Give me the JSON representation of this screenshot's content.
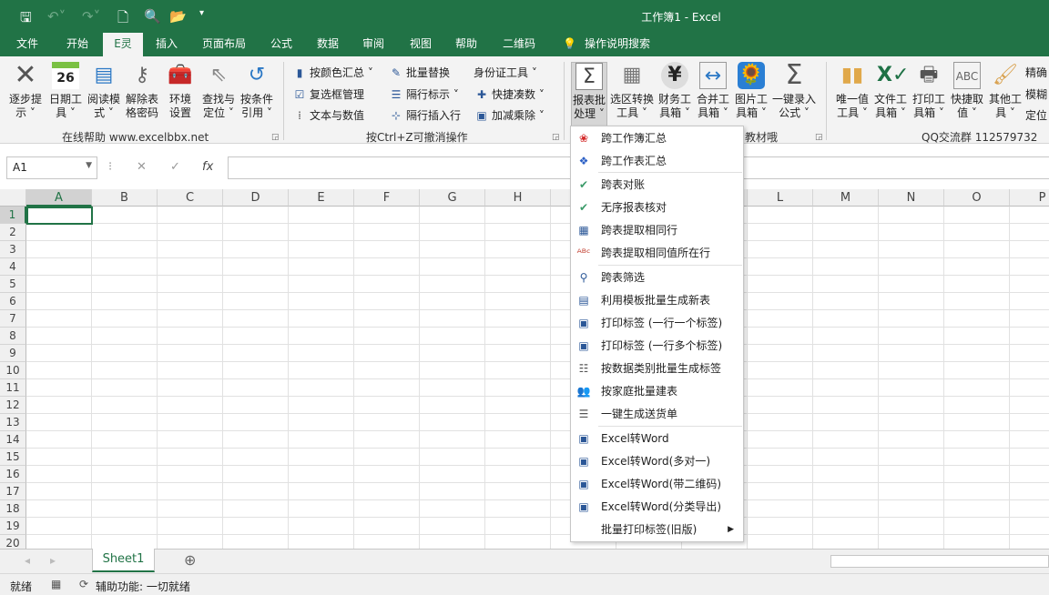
{
  "title": "工作簿1  -  Excel",
  "quick_access": [
    "save-icon",
    "undo-icon",
    "redo-icon",
    "new-icon",
    "print-preview-icon",
    "open-icon",
    "customize-icon"
  ],
  "tabs": [
    "文件",
    "开始",
    "E灵",
    "插入",
    "页面布局",
    "公式",
    "数据",
    "审阅",
    "视图",
    "帮助",
    "二维码",
    "操作说明搜索"
  ],
  "active_tab": "E灵",
  "ribbon": {
    "group1": {
      "label": "在线帮助  www.excelbbx.net",
      "buttons": [
        [
          "逐步提",
          "示 ˅"
        ],
        [
          "日期工",
          "具 ˅"
        ],
        [
          "阅读模",
          "式 ˅"
        ],
        [
          "解除表",
          "格密码"
        ],
        [
          "环境",
          "设置"
        ],
        [
          "查找与",
          "定位 ˅"
        ],
        [
          "按条件",
          "引用 ˅"
        ]
      ],
      "calendar_day": "26"
    },
    "group2": {
      "label": "按Ctrl+Z可撤消操作",
      "items": [
        "按颜色汇总 ˅",
        "复选框管理",
        "文本与数值",
        "批量替换",
        "隔行标示 ˅",
        "隔行插入行",
        "身份证工具 ˅",
        "快捷凑数 ˅",
        "加减乘除 ˅"
      ]
    },
    "group3": {
      "label": "教材哦",
      "buttons": [
        [
          "报表批",
          "处理 ˅"
        ],
        [
          "选区转换",
          "工具 ˅"
        ],
        [
          "财务工",
          "具箱 ˅"
        ],
        [
          "合并工",
          "具箱 ˅"
        ],
        [
          "图片工",
          "具箱 ˅"
        ],
        [
          "一键录入",
          "公式 ˅"
        ]
      ]
    },
    "group4": {
      "label": "QQ交流群  112579732",
      "buttons": [
        [
          "唯一值",
          "工具 ˅"
        ],
        [
          "文件工",
          "具箱 ˅"
        ],
        [
          "打印工",
          "具箱 ˅"
        ],
        [
          "快捷取",
          "值 ˅"
        ],
        [
          "其他工",
          "具 ˅"
        ]
      ],
      "side": [
        "精确",
        "模糊",
        "定位"
      ]
    }
  },
  "name_box": "A1",
  "formula_icons": [
    "✕",
    "✓",
    "fx"
  ],
  "formula_value": "",
  "columns": [
    "A",
    "B",
    "C",
    "D",
    "E",
    "F",
    "G",
    "H",
    "I",
    "J",
    "K",
    "L",
    "M",
    "N",
    "O",
    "P"
  ],
  "rows": [
    "1",
    "2",
    "3",
    "4",
    "5",
    "6",
    "7",
    "8",
    "9",
    "10",
    "11",
    "12",
    "13",
    "14",
    "15",
    "16",
    "17",
    "18",
    "19",
    "20"
  ],
  "active_cell": "A1",
  "sheets": [
    "Sheet1"
  ],
  "status": {
    "ready": "就绪",
    "accessibility": "辅助功能: 一切就绪"
  },
  "menu": [
    {
      "label": "跨工作簿汇总",
      "icon": "workbook-merge-icon"
    },
    {
      "label": "跨工作表汇总",
      "icon": "sheet-merge-icon"
    },
    {
      "label": "跨表对账",
      "icon": "check-icon"
    },
    {
      "label": "无序报表核对",
      "icon": "check-icon"
    },
    {
      "label": "跨表提取相同行",
      "icon": "table-icon"
    },
    {
      "label": "跨表提取相同值所在行",
      "icon": "abc-icon"
    },
    {
      "label": "跨表筛选",
      "icon": "search-icon"
    },
    {
      "label": "利用模板批量生成新表",
      "icon": "template-icon"
    },
    {
      "label": "打印标签 (一行一个标签)",
      "icon": "label-icon"
    },
    {
      "label": "打印标签 (一行多个标签)",
      "icon": "label-icon"
    },
    {
      "label": "按数据类别批量生成标签",
      "icon": "list-icon"
    },
    {
      "label": "按家庭批量建表",
      "icon": "family-icon"
    },
    {
      "label": "一键生成送货单",
      "icon": "invoice-icon"
    },
    {
      "label": "Excel转Word",
      "icon": "word-icon"
    },
    {
      "label": "Excel转Word(多对一)",
      "icon": "word-icon"
    },
    {
      "label": "Excel转Word(带二维码)",
      "icon": "word-icon"
    },
    {
      "label": "Excel转Word(分类导出)",
      "icon": "word-icon"
    },
    {
      "label": "批量打印标签(旧版)",
      "icon": "",
      "submenu": true
    }
  ],
  "colors": {
    "accent": "#217346",
    "ribbon_bg": "#f3f3f3"
  }
}
